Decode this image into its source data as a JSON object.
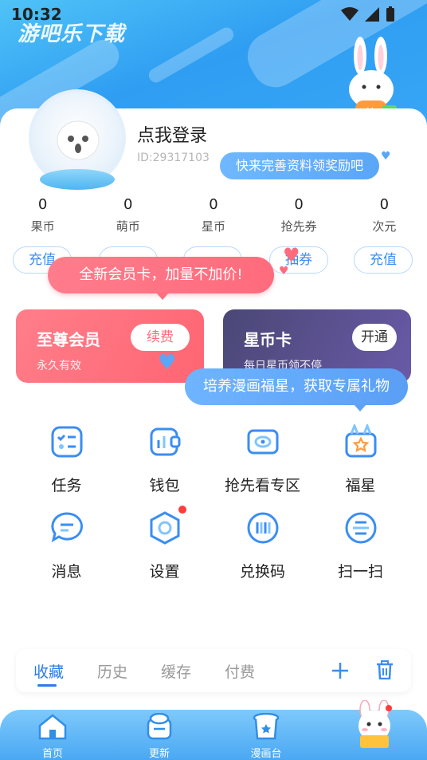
{
  "status": {
    "time": "10:32"
  },
  "watermark": "游吧乐下载",
  "profile": {
    "login_label": "点我登录",
    "id_text": "ID:29317103",
    "tip": "快来完善资料领奖励吧"
  },
  "stats": [
    {
      "value": "0",
      "label": "果币"
    },
    {
      "value": "0",
      "label": "萌币"
    },
    {
      "value": "0",
      "label": "星币"
    },
    {
      "value": "0",
      "label": "抢先券"
    },
    {
      "value": "0",
      "label": "次元"
    }
  ],
  "stat_buttons": {
    "b1": "充值",
    "b4": "抽券",
    "b5": "充值"
  },
  "promo_tip": "全新会员卡，加量不加价!",
  "vip_card": {
    "title": "至尊会员",
    "subtitle": "永久有效",
    "button": "续费"
  },
  "star_card": {
    "title": "星币卡",
    "subtitle": "每日星币领不停",
    "button": "开通"
  },
  "grow_tip": "培养漫画福星，获取专属礼物",
  "grid": [
    {
      "label": "任务",
      "icon": "task-icon"
    },
    {
      "label": "钱包",
      "icon": "wallet-icon"
    },
    {
      "label": "抢先看专区",
      "icon": "preview-icon"
    },
    {
      "label": "福星",
      "icon": "lucky-star-icon"
    },
    {
      "label": "消息",
      "icon": "message-icon"
    },
    {
      "label": "设置",
      "icon": "settings-icon"
    },
    {
      "label": "兑换码",
      "icon": "redeem-code-icon"
    },
    {
      "label": "扫一扫",
      "icon": "scan-icon"
    }
  ],
  "tabs": [
    {
      "label": "收藏"
    },
    {
      "label": "历史"
    },
    {
      "label": "缓存"
    },
    {
      "label": "付费"
    }
  ],
  "bottom_nav": [
    {
      "label": "首页"
    },
    {
      "label": "更新"
    },
    {
      "label": "漫画台"
    },
    {
      "label": ""
    }
  ],
  "colors": {
    "primary": "#2b7be8",
    "vip": "#ff6b7d",
    "star_card": "#4a4775",
    "header": "#3aa8f5"
  }
}
